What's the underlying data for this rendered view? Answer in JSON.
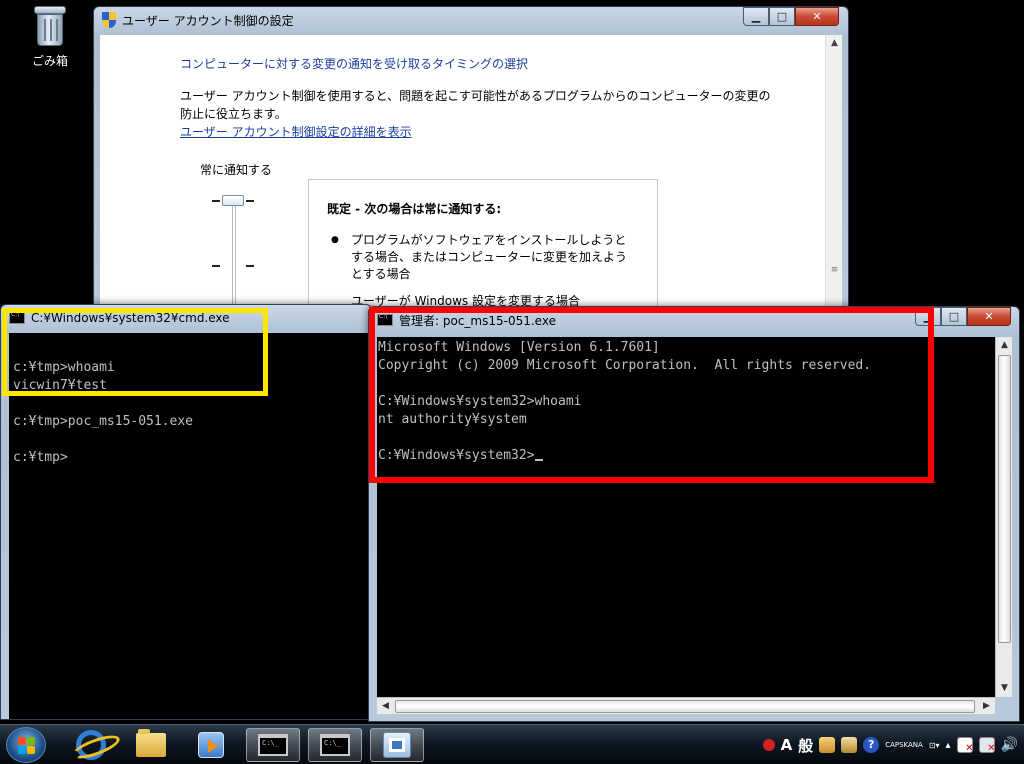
{
  "desktop": {
    "recycle_bin_label": "ごみ箱"
  },
  "uac_window": {
    "title": "ユーザー アカウント制御の設定",
    "heading": "コンピューターに対する変更の通知を受け取るタイミングの選択",
    "description": "ユーザー アカウント制御を使用すると、問題を起こす可能性があるプログラムからのコンピューターの変更の防止に役立ちます。",
    "link": "ユーザー アカウント制御設定の詳細を表示",
    "slider_top_label": "常に通知する",
    "box_title": "既定 - 次の場合は常に通知する:",
    "bullet1": "プログラムがソフトウェアをインストールしようとする場合、またはコンピューターに変更を加えようとする場合",
    "bullet2_partial": "ユーザーが Windows 設定を変更する場合"
  },
  "cmd_user": {
    "title": "C:¥Windows¥system32¥cmd.exe",
    "lines": [
      "",
      "c:¥tmp>whoami",
      "vicwin7¥test",
      "",
      "c:¥tmp>poc_ms15-051.exe",
      "",
      "c:¥tmp>"
    ]
  },
  "cmd_admin": {
    "title": "管理者: poc_ms15-051.exe",
    "lines": [
      "Microsoft Windows [Version 6.1.7601]",
      "Copyright (c) 2009 Microsoft Corporation.  All rights reserved.",
      "",
      "C:¥Windows¥system32>whoami",
      "nt authority¥system",
      "",
      "C:¥Windows¥system32>"
    ]
  },
  "window_buttons": {
    "minimize": "▁",
    "maximize": "□",
    "close": "✕"
  },
  "taskbar": {
    "cmd_icon_text": "C:\\_",
    "tray": {
      "ime_mode": "A",
      "ime_kanji": "般",
      "caps": "CAPS",
      "kana": "KANA"
    }
  },
  "colors": {
    "highlight_user": "#ffe600",
    "highlight_admin": "#ff0000",
    "console_text": "#c0c0c0",
    "uac_link": "#1a3e9c"
  }
}
